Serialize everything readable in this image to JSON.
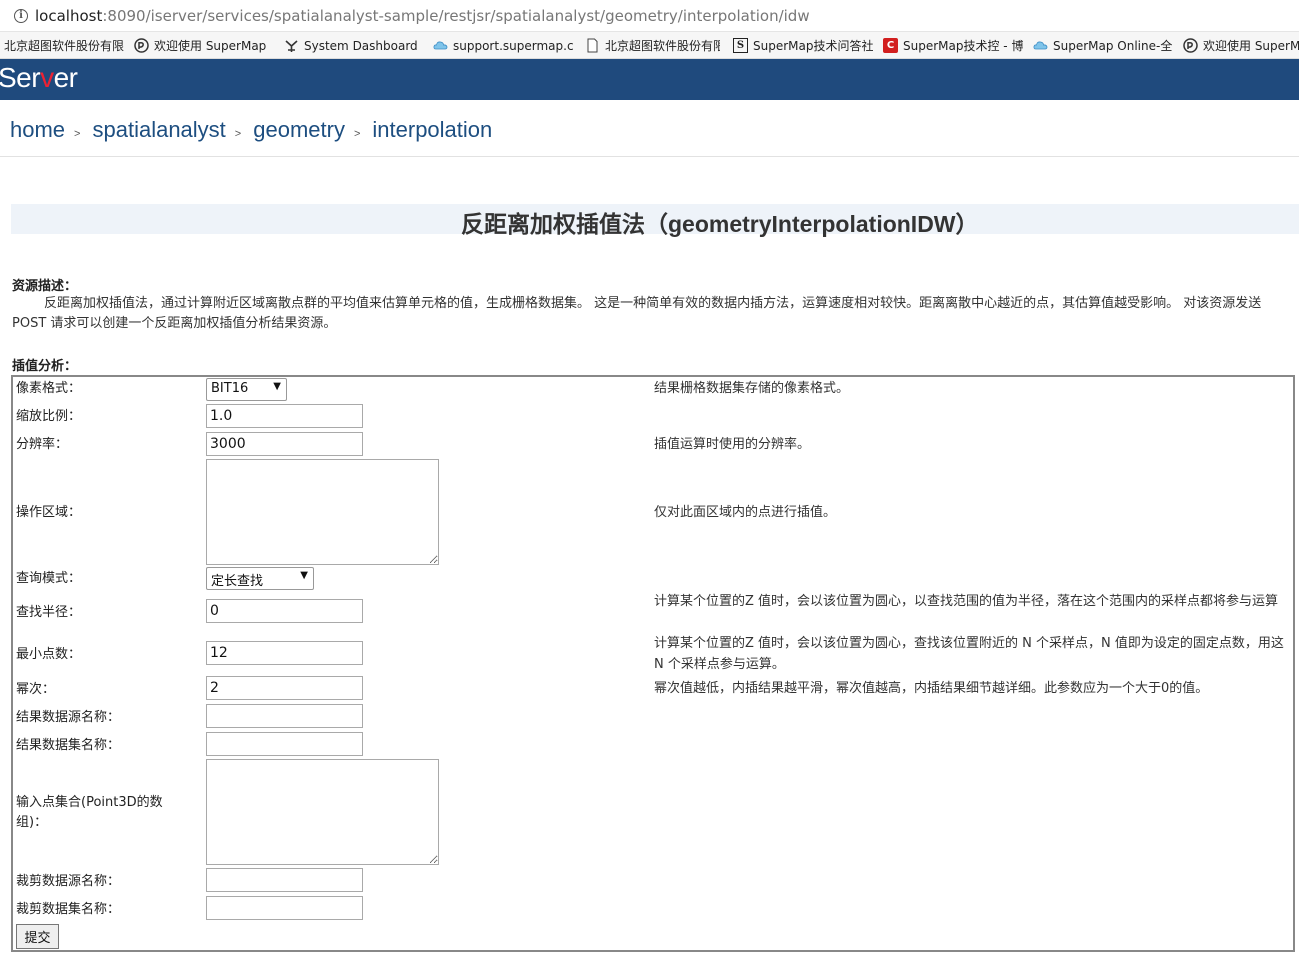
{
  "browser": {
    "url_host": "localhost",
    "url_path": ":8090/iserver/services/spatialanalyst-sample/restjsr/spatialanalyst/geometry/interpolation/idw",
    "bookmarks": [
      {
        "label": "北京超图软件股份有限",
        "icon": "blank"
      },
      {
        "label": "欢迎使用 SuperMap",
        "icon": "supermap-icon"
      },
      {
        "label": "System Dashboard",
        "icon": "dashboard-icon"
      },
      {
        "label": "support.supermap.c",
        "icon": "cloud-icon"
      },
      {
        "label": "北京超图软件股份有限",
        "icon": "page-icon"
      },
      {
        "label": "SuperMap技术问答社",
        "icon": "s-icon"
      },
      {
        "label": "SuperMap技术控 - 博",
        "icon": "c-icon"
      },
      {
        "label": "SuperMap Online-全",
        "icon": "cloud-icon"
      },
      {
        "label": "欢迎使用 SuperMap",
        "icon": "supermap-icon"
      }
    ]
  },
  "header": {
    "logo_text": "Server",
    "banner_color": "#1f4a7d"
  },
  "breadcrumb": {
    "items": [
      "home",
      "spatialanalyst",
      "geometry",
      "interpolation"
    ],
    "separator": ">"
  },
  "page": {
    "title": "反距离加权插值法（geometryInterpolationIDW）",
    "desc_label": "资源描述：",
    "description": "反距离加权插值法，通过计算附近区域离散点群的平均值来估算单元格的值，生成栅格数据集。 这是一种简单有效的数据内插方法，运算速度相对较快。距离离散中心越近的点，其估算值越受影响。 对该资源发送POST 请求可以创建一个反距离加权插值分析结果资源。",
    "form_label": "插值分析："
  },
  "form": {
    "pixel_format": {
      "label": "像素格式：",
      "value": "BIT16",
      "help": "结果栅格数据集存储的像素格式。"
    },
    "zoom_scale": {
      "label": "缩放比例：",
      "value": "1.0",
      "help": ""
    },
    "resolution": {
      "label": "分辨率：",
      "value": "3000",
      "help": "插值运算时使用的分辨率。"
    },
    "clip_region": {
      "label": "操作区域：",
      "value": "",
      "help": "仅对此面区域内的点进行插值。"
    },
    "search_mode": {
      "label": "查询模式：",
      "value": "定长查找",
      "help": ""
    },
    "search_radius": {
      "label": "查找半径：",
      "value": "0",
      "help": "计算某个位置的Z 值时，会以该位置为圆心，以查找范围的值为半径，落在这个范围内的采样点都将参与运算"
    },
    "min_points": {
      "label": "最小点数：",
      "value": "12",
      "help": "计算某个位置的Z 值时，会以该位置为圆心，查找该位置附近的 N 个采样点，N 值即为设定的固定点数，用这 N 个采样点参与运算。"
    },
    "power": {
      "label": "幂次：",
      "value": "2",
      "help": "幂次值越低，内插结果越平滑，幂次值越高，内插结果细节越详细。此参数应为一个大于0的值。"
    },
    "result_datasource": {
      "label": "结果数据源名称：",
      "value": ""
    },
    "result_dataset": {
      "label": "结果数据集名称：",
      "value": ""
    },
    "input_points": {
      "label": "输入点集合(Point3D的数组)：",
      "value": ""
    },
    "clip_datasource": {
      "label": "裁剪数据源名称：",
      "value": ""
    },
    "clip_dataset": {
      "label": "裁剪数据集名称：",
      "value": ""
    },
    "submit_label": "提交"
  }
}
